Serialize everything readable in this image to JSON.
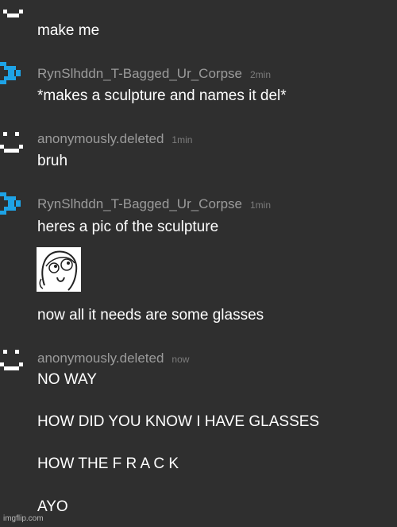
{
  "colors": {
    "background": "#2f2f2f",
    "username": "#9b9b9b",
    "timestamp": "#7c7c7c",
    "message": "#ffffff",
    "blue_avatar": "#1ea3e6",
    "white_avatar": "#ffffff"
  },
  "messages": [
    {
      "avatar": "smiley-avatar-icon",
      "lines": [
        "make me"
      ]
    },
    {
      "avatar": "blue-pixel-avatar-icon",
      "username": "RynSlhddn_T-Bagged_Ur_Corpse",
      "time": "2min",
      "lines": [
        "*makes a sculpture and names it del*"
      ]
    },
    {
      "avatar": "smiley-avatar-icon",
      "username": "anonymously.deleted",
      "time": "1min",
      "lines": [
        "bruh"
      ]
    },
    {
      "avatar": "blue-pixel-avatar-icon",
      "username": "RynSlhddn_T-Bagged_Ur_Corpse",
      "time": "1min",
      "lines": [
        "heres a pic of the sculpture",
        "now all it needs are some glasses"
      ],
      "image": "derp-face-meme-image"
    },
    {
      "avatar": "smiley-avatar-icon",
      "username": "anonymously.deleted",
      "time": "now",
      "lines": [
        "NO WAY",
        "HOW DID YOU KNOW I HAVE GLASSES",
        "HOW THE F R A C K",
        "AYO"
      ]
    }
  ],
  "watermark": "imgflip.com"
}
